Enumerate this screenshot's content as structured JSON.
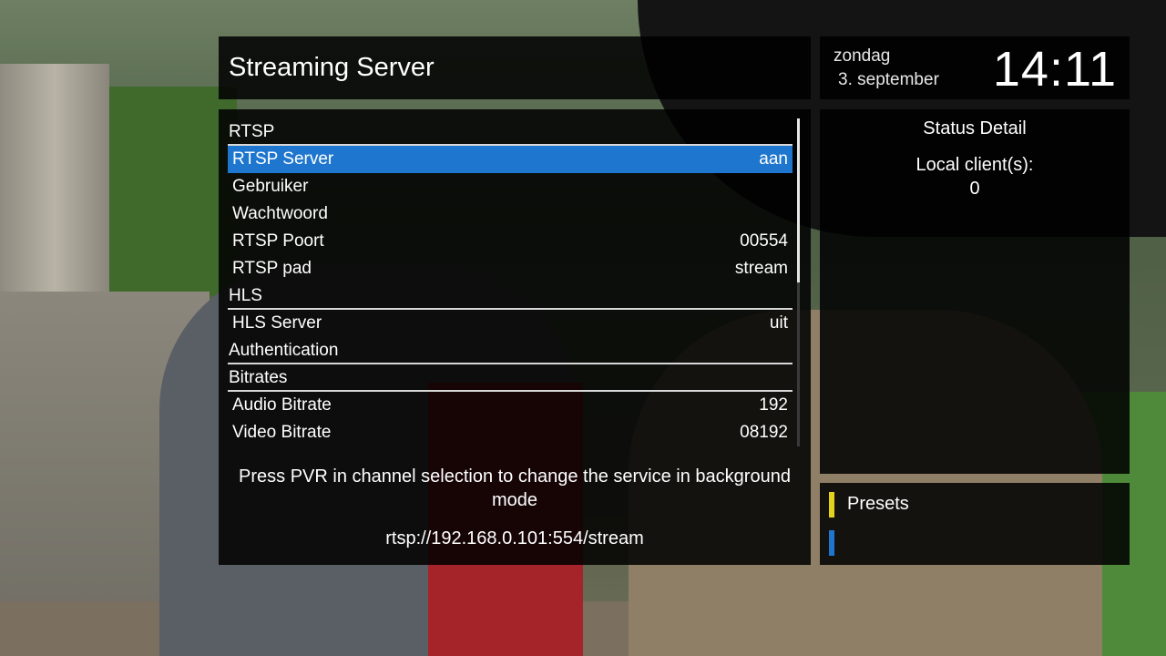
{
  "header": {
    "title": "Streaming Server"
  },
  "clock": {
    "day": "zondag",
    "date": "3. september",
    "time": "14:11"
  },
  "menu": {
    "rows": [
      {
        "label": "RTSP",
        "value": "",
        "type": "section"
      },
      {
        "label": "RTSP Server",
        "value": "aan",
        "type": "item",
        "selected": true
      },
      {
        "label": "Gebruiker",
        "value": "",
        "type": "item"
      },
      {
        "label": "Wachtwoord",
        "value": "",
        "type": "item"
      },
      {
        "label": "RTSP Poort",
        "value": "00554",
        "type": "item"
      },
      {
        "label": "RTSP pad",
        "value": "stream",
        "type": "item"
      },
      {
        "label": "HLS",
        "value": "",
        "type": "section"
      },
      {
        "label": "HLS Server",
        "value": "uit",
        "type": "item"
      },
      {
        "label": "Authentication",
        "value": "",
        "type": "section"
      },
      {
        "label": "Bitrates",
        "value": "",
        "type": "section"
      },
      {
        "label": "Audio Bitrate",
        "value": "192",
        "type": "item"
      },
      {
        "label": "Video Bitrate",
        "value": "08192",
        "type": "item"
      }
    ],
    "hint": "Press PVR in channel selection to change the service in background mode",
    "url": "rtsp://192.168.0.101:554/stream"
  },
  "status": {
    "heading": "Status Detail",
    "clients_label": "Local client(s):",
    "clients_count": "0"
  },
  "keys": {
    "yellow_label": "Presets",
    "blue_label": "",
    "yellow_color": "#e2d21b",
    "blue_color": "#1e76cf"
  },
  "colors": {
    "selection": "#1e76cf",
    "panel": "#000000"
  }
}
